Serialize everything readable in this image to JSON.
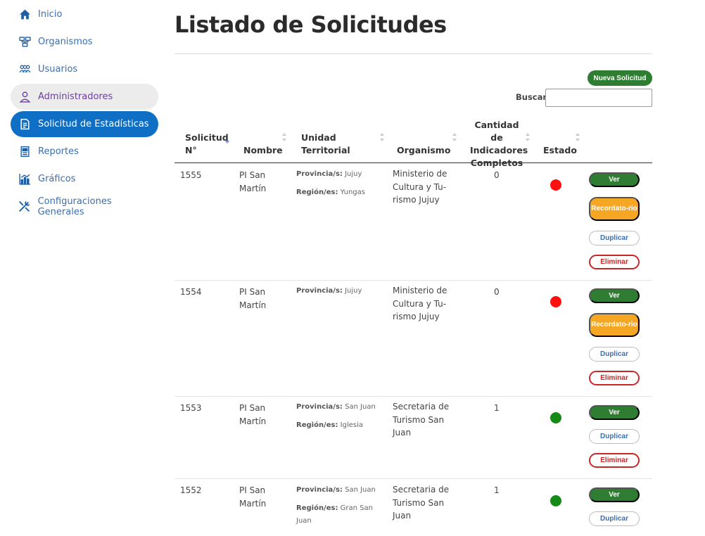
{
  "sidebar": {
    "items": [
      {
        "label": "Inicio",
        "icon": "home-icon"
      },
      {
        "label": "Organismos",
        "icon": "organization-icon"
      },
      {
        "label": "Usuarios",
        "icon": "users-icon"
      },
      {
        "label": "Administradores",
        "icon": "admin-icon"
      },
      {
        "label": "Solicitud de Estadísticas",
        "icon": "document-icon"
      },
      {
        "label": "Reportes",
        "icon": "report-icon"
      },
      {
        "label": "Gráficos",
        "icon": "chart-icon"
      },
      {
        "label": "Configuraciones Generales",
        "icon": "tools-icon"
      }
    ]
  },
  "page": {
    "title": "Listado de Solicitudes",
    "new_button": "Nueva Solicitud",
    "search_label": "Buscar:",
    "search_value": ""
  },
  "table": {
    "headers": {
      "solicitud": [
        "Solicitud",
        "N°"
      ],
      "nombre": "Nombre",
      "unidad": [
        "Unidad",
        "Territorial"
      ],
      "organismo": "Organismo",
      "cantidad": [
        "Cantidad de",
        "Indicadores",
        "Completos"
      ],
      "estado": "Estado"
    },
    "prov_label": "Provincia/s:",
    "reg_label": "Región/es:",
    "actions": {
      "ver": "Ver",
      "recordatorio": [
        "Recordato-",
        "rio"
      ],
      "duplicar": "Duplicar",
      "eliminar": "Eliminar"
    },
    "rows": [
      {
        "id": "1555",
        "nombre": [
          "PI San",
          "Martín"
        ],
        "provincia": "Jujuy",
        "region": "Yungas",
        "organismo": [
          "Ministerio de",
          "Cultura y Tu-",
          "rismo Jujuy"
        ],
        "cantidad": "0",
        "estado_color": "#ff1010"
      },
      {
        "id": "1554",
        "nombre": [
          "PI San",
          "Martín"
        ],
        "provincia": "Jujuy",
        "region": "",
        "organismo": [
          "Ministerio de",
          "Cultura y Tu-",
          "rismo Jujuy"
        ],
        "cantidad": "0",
        "estado_color": "#ff1010"
      },
      {
        "id": "1553",
        "nombre": [
          "PI San",
          "Martín"
        ],
        "provincia": "San Juan",
        "region": "Iglesia",
        "organismo": [
          "Secretaria de",
          "Turismo San",
          "Juan"
        ],
        "cantidad": "1",
        "estado_color": "#158a16"
      },
      {
        "id": "1552",
        "nombre": [
          "PI San",
          "Martín"
        ],
        "provincia": "San Juan",
        "region": [
          "Gran San",
          "Juan"
        ],
        "organismo": [
          "Secretaria de",
          "Turismo San",
          "Juan"
        ],
        "cantidad": "1",
        "estado_color": "#158a16"
      }
    ]
  },
  "colors": {
    "primary": "#0f6fc5",
    "success": "#2e7d32",
    "warning": "#f5a623",
    "danger": "#c62828"
  }
}
